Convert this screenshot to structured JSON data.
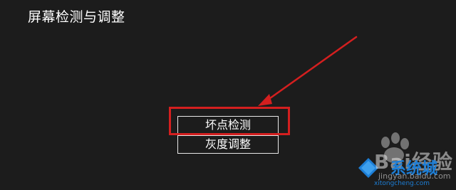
{
  "page": {
    "title": "屏幕检测与调整"
  },
  "buttons": {
    "dead_pixel_label": "坏点检测",
    "gray_adjust_label": "灰度调整"
  },
  "annotation": {
    "highlight_color": "#d41f1f"
  },
  "watermark": {
    "baidu_text": "Bai经验",
    "jingyan_url": "jingyan.baidu.com",
    "site_brand": "系统城",
    "site_url": "xitongcheng.com"
  }
}
